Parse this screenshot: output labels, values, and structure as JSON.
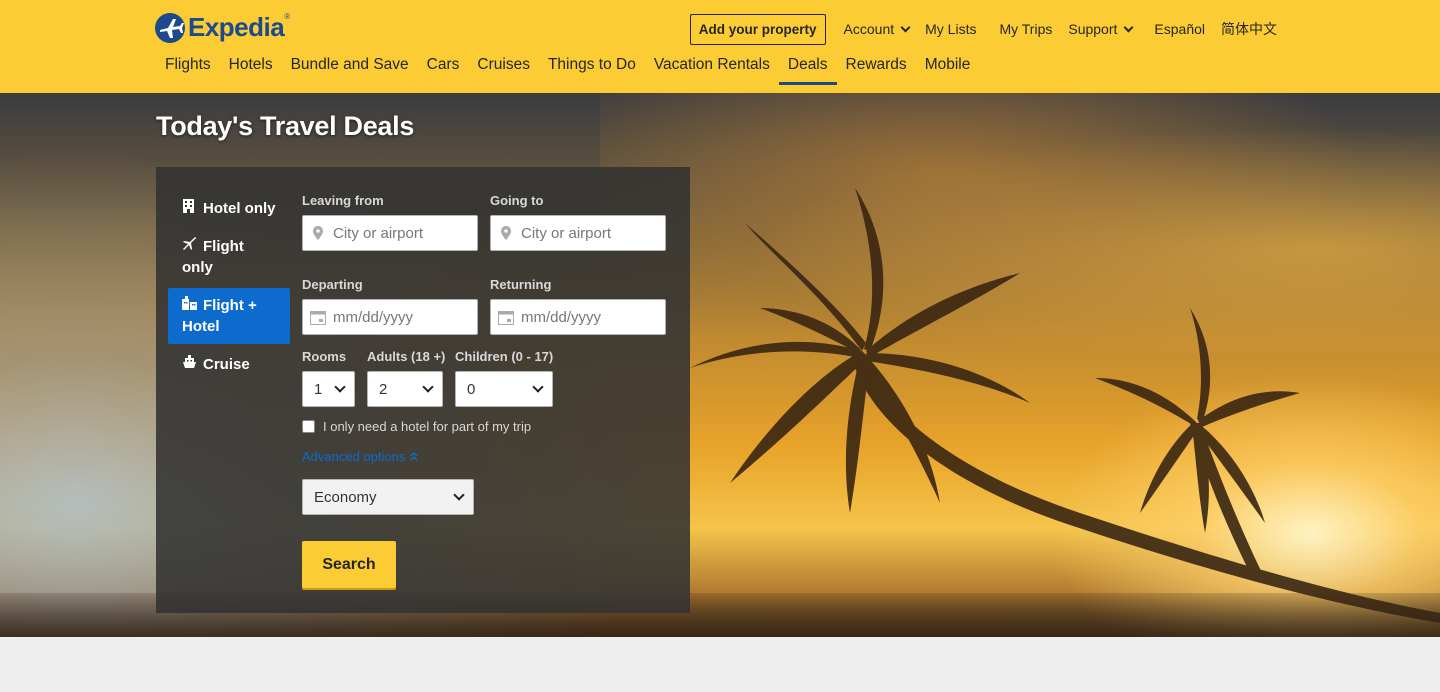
{
  "brand": {
    "name": "Expedia",
    "colors": {
      "header": "#fbcc33",
      "brand_blue": "#1b4a8d",
      "active_blue": "#0c6bcc",
      "button_yellow": "#fbcc33"
    }
  },
  "utility_nav": {
    "add_property": "Add your property",
    "account": "Account",
    "my_lists": "My Lists",
    "my_trips": "My Trips",
    "support": "Support",
    "espanol": "Español",
    "chinese": "简体中文"
  },
  "main_nav": {
    "items": [
      {
        "label": "Flights"
      },
      {
        "label": "Hotels"
      },
      {
        "label": "Bundle and Save"
      },
      {
        "label": "Cars"
      },
      {
        "label": "Cruises"
      },
      {
        "label": "Things to Do"
      },
      {
        "label": "Vacation Rentals"
      },
      {
        "label": "Deals"
      },
      {
        "label": "Rewards"
      },
      {
        "label": "Mobile"
      }
    ],
    "active": "Deals"
  },
  "hero": {
    "title": "Today's Travel Deals"
  },
  "search_panel": {
    "types": [
      {
        "label": "Hotel only",
        "icon": "hotel-icon"
      },
      {
        "label": "Flight only",
        "icon": "plane-icon"
      },
      {
        "label": "Flight + Hotel",
        "icon": "flight-hotel-icon"
      },
      {
        "label": "Cruise",
        "icon": "cruise-icon"
      }
    ],
    "active_type": "Flight + Hotel",
    "leaving_from": {
      "label": "Leaving from",
      "placeholder": "City or airport",
      "value": ""
    },
    "going_to": {
      "label": "Going to",
      "placeholder": "City or airport",
      "value": ""
    },
    "departing": {
      "label": "Departing",
      "placeholder": "mm/dd/yyyy",
      "value": ""
    },
    "returning": {
      "label": "Returning",
      "placeholder": "mm/dd/yyyy",
      "value": ""
    },
    "rooms": {
      "label": "Rooms",
      "value": "1"
    },
    "adults": {
      "label": "Adults (18 +)",
      "value": "2"
    },
    "children": {
      "label": "Children (0 - 17)",
      "value": "0"
    },
    "partial_hotel": {
      "label": "I only need a hotel for part of my trip",
      "checked": false
    },
    "advanced_options": "Advanced options",
    "cabin_class": {
      "value": "Economy"
    },
    "search_button": "Search"
  }
}
